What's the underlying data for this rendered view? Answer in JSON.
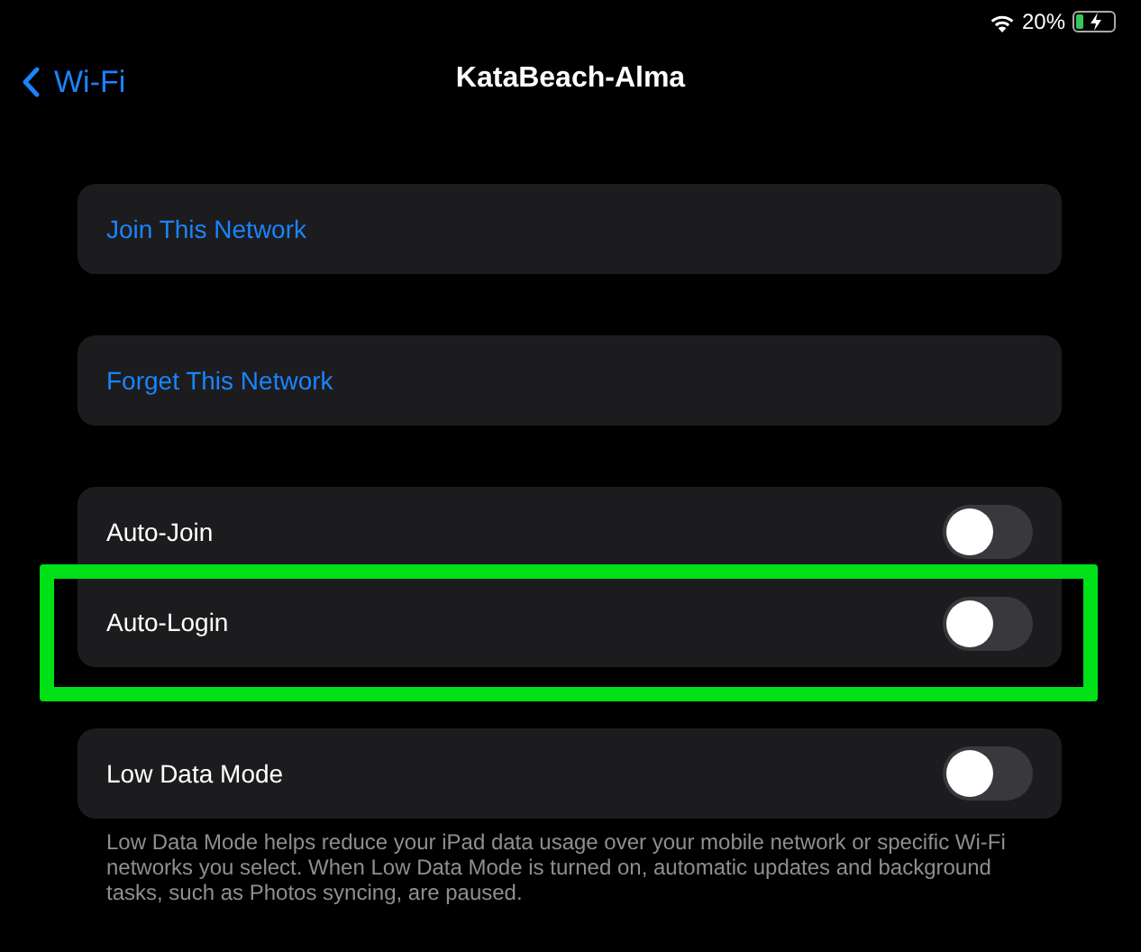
{
  "status_bar": {
    "battery_text": "20%",
    "charging": true
  },
  "nav": {
    "back": "Wi-Fi",
    "title": "KataBeach-Alma"
  },
  "sections": [
    {
      "rows": [
        {
          "kind": "action",
          "label": "Join This Network",
          "highlighted": false
        }
      ]
    },
    {
      "rows": [
        {
          "kind": "action",
          "label": "Forget This Network",
          "highlighted": false
        }
      ]
    },
    {
      "rows": [
        {
          "kind": "toggle",
          "label": "Auto-Join",
          "on": false,
          "highlighted": false
        },
        {
          "kind": "toggle",
          "label": "Auto-Login",
          "on": false,
          "highlighted": true
        }
      ]
    },
    {
      "rows": [
        {
          "kind": "toggle",
          "label": "Low Data Mode",
          "on": false,
          "highlighted": false
        }
      ],
      "footer": "Low Data Mode helps reduce your iPad data usage over your mobile network or specific Wi-Fi networks you select. When Low Data Mode is turned on, automatic updates and background tasks, such as Photos syncing, are paused."
    }
  ]
}
